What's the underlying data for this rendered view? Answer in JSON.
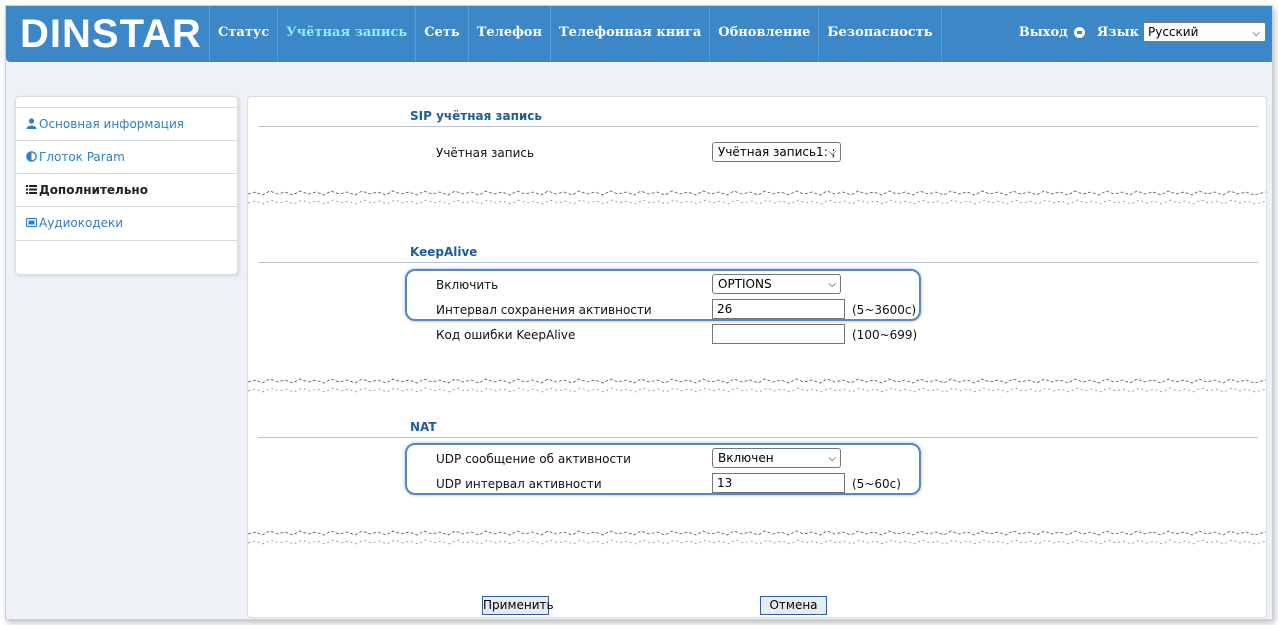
{
  "header": {
    "logo": "DINSTAR",
    "nav": [
      "Статус",
      "Учётная запись",
      "Сеть",
      "Телефон",
      "Телефонная книга",
      "Обновление",
      "Безопасность"
    ],
    "logout_label": "Выход",
    "language_label": "Язык",
    "language_value": "Русский"
  },
  "sidebar": {
    "items": [
      {
        "label": "Основная информация",
        "icon": "user-icon"
      },
      {
        "label": "Глоток Param",
        "icon": "half-circle-icon"
      },
      {
        "label": "Дополнительно",
        "icon": "list-icon"
      },
      {
        "label": "Аудиокодеки",
        "icon": "codec-icon"
      }
    ]
  },
  "sip": {
    "title": "SIP учётная запись",
    "account_label": "Учётная запись",
    "account_value": "Учётная запись1: ;"
  },
  "keepalive": {
    "title": "KeepAlive",
    "enable_label": "Включить",
    "enable_value": "OPTIONS",
    "interval_label": "Интервал сохранения активности",
    "interval_value": "26",
    "interval_hint": "(5~3600с)",
    "error_label": "Код ошибки KeepAlive",
    "error_value": "",
    "error_hint": "(100~699)"
  },
  "nat": {
    "title": "NAT",
    "udp_msg_label": "UDP сообщение об активности",
    "udp_msg_value": "Включен",
    "udp_interval_label": "UDP интервал активности",
    "udp_interval_value": "13",
    "udp_interval_hint": "(5~60с)"
  },
  "buttons": {
    "apply": "Применить",
    "cancel": "Отмена"
  },
  "colors": {
    "header_bg": "#3b87c7",
    "active_nav": "#8ff0ff",
    "link": "#2e7fc4",
    "section_title": "#1f5e94",
    "highlight": "#5a86bd"
  }
}
